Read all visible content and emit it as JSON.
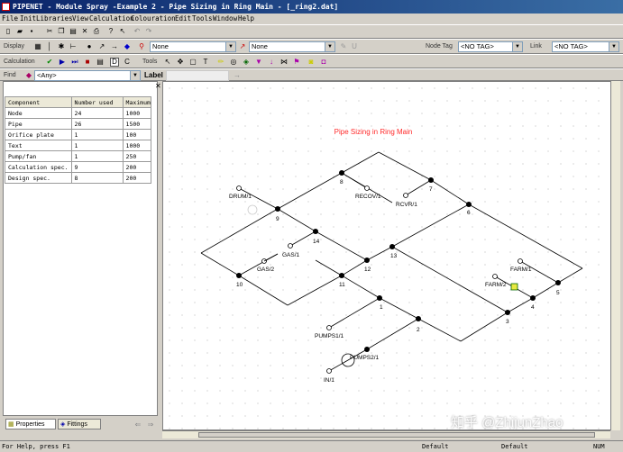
{
  "window": {
    "title": "PIPENET - Module Spray -Example 2 - Pipe Sizing in Ring Main - [_ring2.dat]"
  },
  "menu": [
    "File",
    "Init",
    "Libraries",
    "View",
    "Calculation",
    "Colouration",
    "Edit",
    "Tools",
    "Window",
    "Help"
  ],
  "toolbar2": {
    "display_label": "Display",
    "combo1_value": "None",
    "combo2_value": "None",
    "node_tag_label": "Node Tag",
    "node_tag_value": "<NO TAG>",
    "link_label": "Link",
    "link_tag_value": "<NO TAG>"
  },
  "toolbar3": {
    "calculation_label": "Calculation",
    "tools_label": "Tools",
    "d_btn": "D",
    "c_btn": "C"
  },
  "toolbar4": {
    "find_label": "Find",
    "find_value": "<Any>",
    "label_label": "Label"
  },
  "props_table": {
    "headers": [
      "Component",
      "Number used",
      "Maximum"
    ],
    "rows": [
      [
        "Node",
        "24",
        "1000"
      ],
      [
        "Pipe",
        "26",
        "1500"
      ],
      [
        "Orifice plate",
        "1",
        "100"
      ],
      [
        "Text",
        "1",
        "1000"
      ],
      [
        "Pump/fan",
        "1",
        "250"
      ],
      [
        "Calculation spec.",
        "9",
        "200"
      ],
      [
        "Design spec.",
        "8",
        "200"
      ]
    ]
  },
  "tabs": {
    "properties": "Properties",
    "fittings": "Fittings"
  },
  "canvas": {
    "title": "Pipe Sizing in Ring Main",
    "node_numbers": [
      "1",
      "2",
      "3",
      "4",
      "5",
      "6",
      "7",
      "8",
      "9",
      "10",
      "11",
      "12",
      "13",
      "14"
    ],
    "terminal_labels": [
      "DRUM/1",
      "RECOV/1",
      "RCVR/1",
      "GAS/1",
      "GAS/2",
      "FARM/1",
      "FARM/2",
      "PUMPS1/1",
      "PUMPS2/1",
      "IN/1"
    ]
  },
  "status": {
    "help": "For Help, press F1",
    "s2": "Default",
    "s3": "Default",
    "s4": "NUM"
  },
  "watermark": "知乎 @ZhijunZhao",
  "colors": {
    "title_text": "#ff2a2a",
    "titlebar": "#0a246a"
  }
}
